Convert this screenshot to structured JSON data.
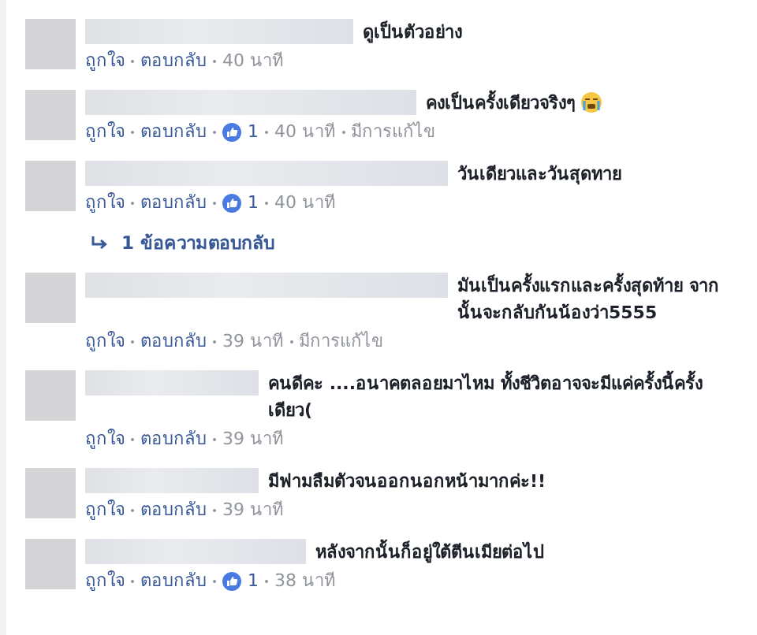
{
  "comments": [
    {
      "text": "ดูเป็นตัวอย่าง",
      "crying_emoji": false,
      "like": "ถูกใจ",
      "reply": "ตอบกลับ",
      "time": "40 นาที"
    },
    {
      "text": "คงเป็นครั้งเดียวจริงๆ",
      "crying_emoji": true,
      "like": "ถูกใจ",
      "reply": "ตอบกลับ",
      "likes": "1",
      "time": "40 นาที",
      "edited": "มีการแก้ไข"
    },
    {
      "text": "วันเดียวและวันสุดทาย",
      "crying_emoji": false,
      "like": "ถูกใจ",
      "reply": "ตอบกลับ",
      "likes": "1",
      "time": "40 นาที",
      "replies": "1 ข้อความตอบกลับ"
    },
    {
      "text": "มันเป็นครั้งแรกและครั้งสุดท้าย จากนั้นจะกลับกันน้องว่า5555",
      "crying_emoji": false,
      "like": "ถูกใจ",
      "reply": "ตอบกลับ",
      "time": "39 นาที",
      "edited": "มีการแก้ไข"
    },
    {
      "text": "คนดีคะ ....อนาคตลอยมาไหม ทั้งชีวิตอาจจะมีแค่ครั้งนี้ครั้งเดียว(",
      "crying_emoji": false,
      "like": "ถูกใจ",
      "reply": "ตอบกลับ",
      "time": "39 นาที"
    },
    {
      "text": "มีฟามลืมตัวจนออกนอกหน้ามากค่ะ!!",
      "crying_emoji": false,
      "like": "ถูกใจ",
      "reply": "ตอบกลับ",
      "time": "39 นาที"
    },
    {
      "text": "หลังจากนั้นก็อยู่ใต้ตีนเมียต่อไป",
      "crying_emoji": false,
      "like": "ถูกใจ",
      "reply": "ตอบกลับ",
      "likes": "1",
      "time": "38 นาที"
    }
  ]
}
